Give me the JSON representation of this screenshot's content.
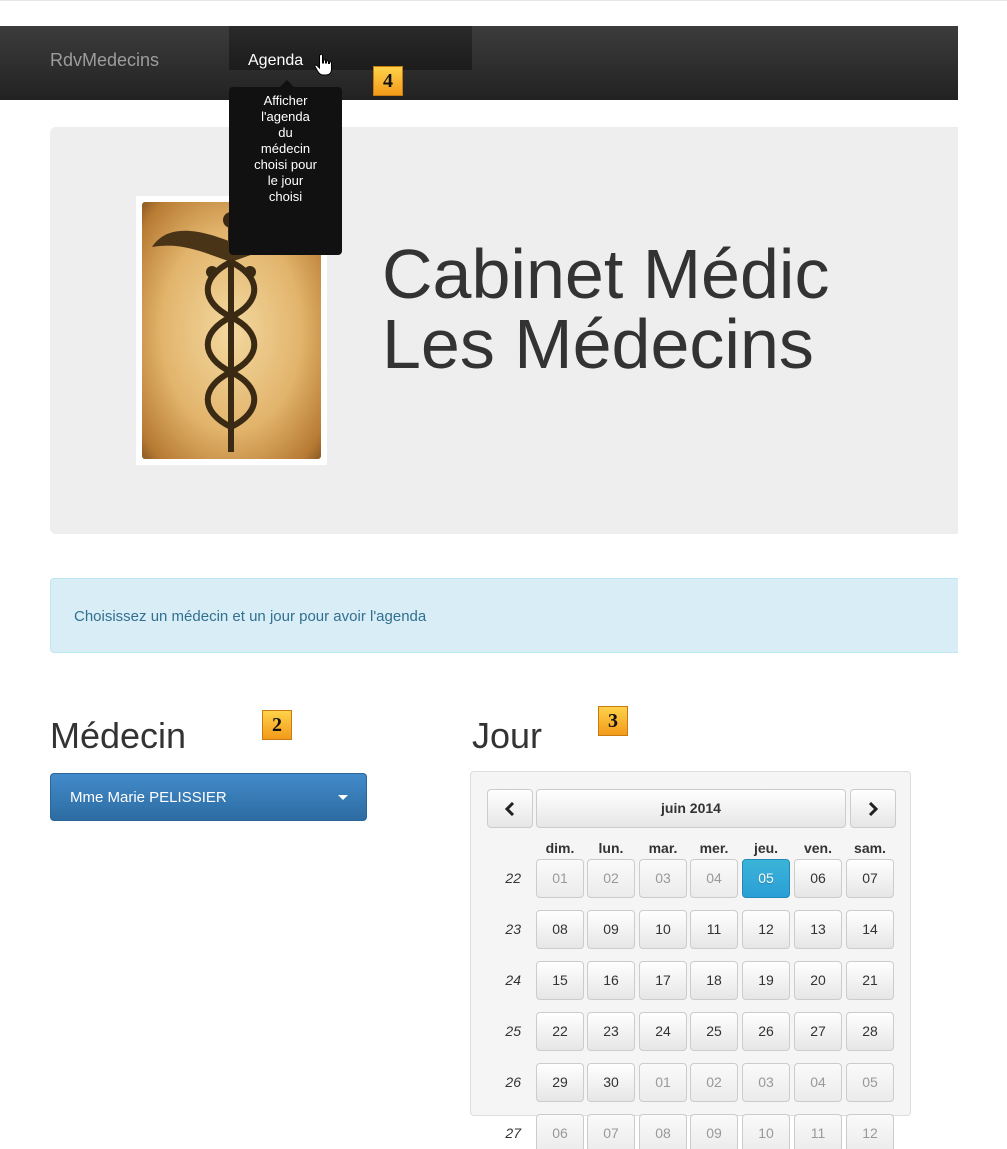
{
  "navbar": {
    "brand": "RdvMedecins",
    "agenda_label": "Agenda",
    "tooltip_lines": [
      "Afficher",
      "l'agenda",
      "du",
      "médecin",
      "choisi pour",
      "le jour",
      "choisi"
    ]
  },
  "badges": {
    "b2": "2",
    "b3": "3",
    "b4": "4"
  },
  "jumbotron": {
    "line1": "Cabinet Médic",
    "line2": "Les Médecins"
  },
  "alert": {
    "text": "Choisissez un médecin et un jour pour avoir l'agenda"
  },
  "medecin": {
    "heading": "Médecin",
    "selected": "Mme Marie PELISSIER"
  },
  "jour": {
    "heading": "Jour",
    "month_title": "juin 2014",
    "prev_icon": "chevron-left-icon",
    "next_icon": "chevron-right-icon",
    "days_of_week": [
      "dim.",
      "lun.",
      "mar.",
      "mer.",
      "jeu.",
      "ven.",
      "sam."
    ],
    "weeks": [
      {
        "num": "22",
        "days": [
          "01",
          "02",
          "03",
          "04",
          "05",
          "06",
          "07"
        ]
      },
      {
        "num": "23",
        "days": [
          "08",
          "09",
          "10",
          "11",
          "12",
          "13",
          "14"
        ]
      },
      {
        "num": "24",
        "days": [
          "15",
          "16",
          "17",
          "18",
          "19",
          "20",
          "21"
        ]
      },
      {
        "num": "25",
        "days": [
          "22",
          "23",
          "24",
          "25",
          "26",
          "27",
          "28"
        ]
      },
      {
        "num": "26",
        "days": [
          "29",
          "30",
          "01",
          "02",
          "03",
          "04",
          "05"
        ]
      },
      {
        "num": "27",
        "days": [
          "06",
          "07",
          "08",
          "09",
          "10",
          "11",
          "12"
        ]
      }
    ],
    "muted_days": [
      [
        0,
        0
      ],
      [
        0,
        1
      ],
      [
        0,
        2
      ],
      [
        0,
        3
      ],
      [
        4,
        2
      ],
      [
        4,
        3
      ],
      [
        4,
        4
      ],
      [
        4,
        5
      ],
      [
        4,
        6
      ],
      [
        5,
        0
      ],
      [
        5,
        1
      ],
      [
        5,
        2
      ],
      [
        5,
        3
      ],
      [
        5,
        4
      ],
      [
        5,
        5
      ],
      [
        5,
        6
      ]
    ],
    "selected_day": [
      0,
      4
    ],
    "selected_color": "#2a9fd6"
  }
}
